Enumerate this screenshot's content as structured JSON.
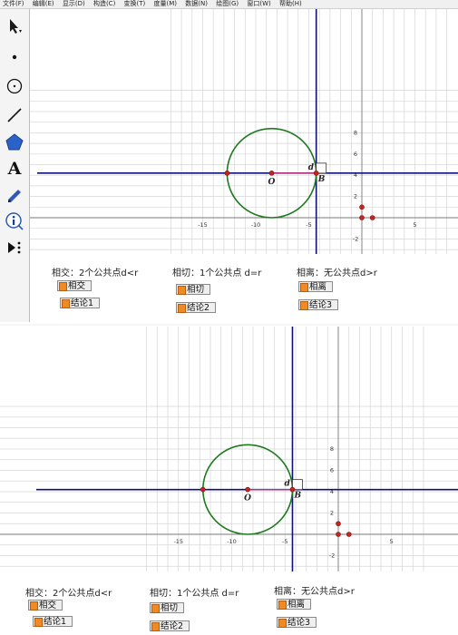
{
  "menu": [
    "文件(F)",
    "编辑(E)",
    "显示(D)",
    "构造(C)",
    "变换(T)",
    "度量(M)",
    "数据(N)",
    "绘图(G)",
    "窗口(W)",
    "帮助(H)"
  ],
  "tools": [
    "arrow-tool",
    "point-tool",
    "compass-tool",
    "line-tool",
    "polygon-tool",
    "text-tool",
    "marker-tool",
    "info-tool",
    "custom-tool"
  ],
  "text_tool_glyph": "A",
  "colors": {
    "circle": "#1e7a1e",
    "axis": "#10107a",
    "segment": "#c0307a",
    "point": "#c8241e",
    "grid": "#d6d6d6",
    "button_mark": "#f08a24"
  },
  "graph": {
    "x_ticks": [
      "-15",
      "-10",
      "-5",
      "5"
    ],
    "y_ticks": [
      "8",
      "6",
      "4",
      "2",
      "-2"
    ],
    "point_o": "O",
    "point_b": "B",
    "label_d": "d"
  },
  "panels": [
    {
      "captions": {
        "intersect": "相交：2个公共点d<r",
        "tangent": "相切：1个公共点 d=r",
        "separate": "相离：无公共点d>r"
      },
      "buttons": {
        "intersect": "相交",
        "conclusion1": "结论1",
        "tangent": "相切",
        "conclusion2": "结论2",
        "separate": "相离",
        "conclusion3": "结论3"
      }
    },
    {
      "captions": {
        "intersect": "相交：2个公共点d<r",
        "tangent": "相切：1个公共点 d=r",
        "separate": "相离：无公共点d>r"
      },
      "buttons": {
        "intersect": "相交",
        "conclusion1": "结论1",
        "tangent": "相切",
        "conclusion2": "结论2",
        "separate": "相离",
        "conclusion3": "结论3"
      }
    }
  ]
}
